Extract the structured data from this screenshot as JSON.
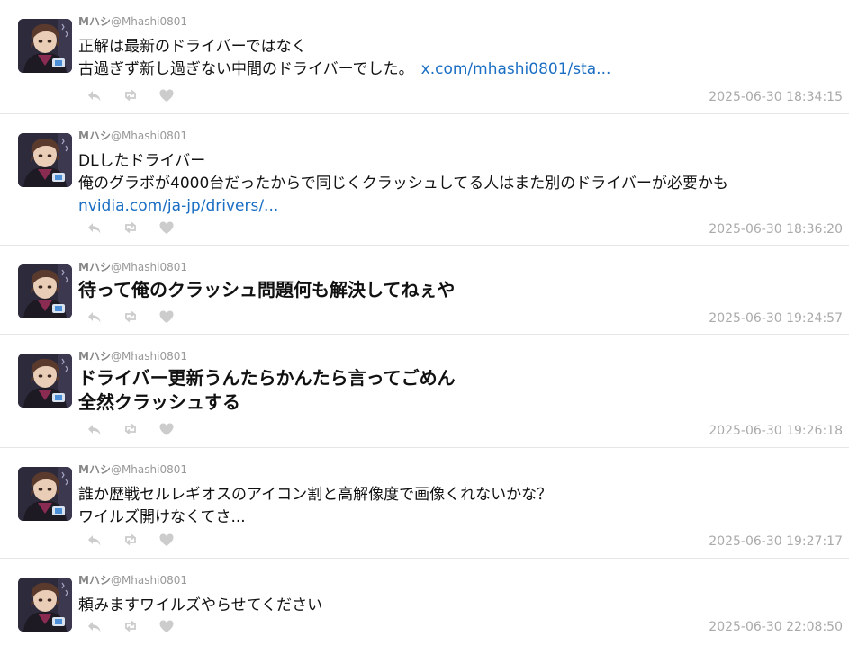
{
  "colors": {
    "link": "#1a6ec4",
    "muted": "#999999",
    "timestamp": "#aaaaaa",
    "action_icon": "#cccccc",
    "divider": "#e6e6e6"
  },
  "action_icons": [
    "reply-icon",
    "retweet-icon",
    "like-icon"
  ],
  "tweets": [
    {
      "name": "Mハシ",
      "handle": "@Mhashi0801",
      "lines": [
        "正解は最新のドライバーではなく",
        "古過ぎず新し過ぎない中間のドライバーでした。"
      ],
      "link": "x.com/mhashi0801/sta...",
      "timestamp": "2025-06-30 18:34:15"
    },
    {
      "name": "Mハシ",
      "handle": "@Mhashi0801",
      "lines": [
        "DLしたドライバー",
        "俺のグラボが4000台だったからで同じくクラッシュしてる人はまた別のドライバーが必要かも"
      ],
      "link": "nvidia.com/ja-jp/drivers/...",
      "timestamp": "2025-06-30 18:36:20"
    },
    {
      "name": "Mハシ",
      "handle": "@Mhashi0801",
      "lines": [
        "待って俺のクラッシュ問題何も解決してねぇや"
      ],
      "timestamp": "2025-06-30 19:24:57"
    },
    {
      "name": "Mハシ",
      "handle": "@Mhashi0801",
      "lines": [
        "ドライバー更新うんたらかんたら言ってごめん",
        "全然クラッシュする"
      ],
      "timestamp": "2025-06-30 19:26:18"
    },
    {
      "name": "Mハシ",
      "handle": "@Mhashi0801",
      "lines": [
        "誰か歴戦セルレギオスのアイコン割と高解像度で画像くれないかな？",
        "ワイルズ開けなくてさ..."
      ],
      "timestamp": "2025-06-30 19:27:17"
    },
    {
      "name": "Mハシ",
      "handle": "@Mhashi0801",
      "lines": [
        "頼みますワイルズやらせてください"
      ],
      "timestamp": "2025-06-30 22:08:50"
    }
  ]
}
